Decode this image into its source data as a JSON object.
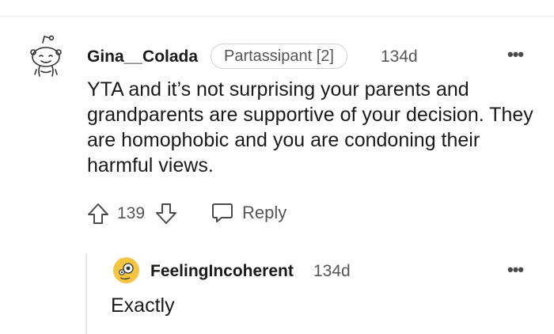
{
  "comment": {
    "username": "Gina__Colada",
    "flair": "Partassipant [2]",
    "time": "134d",
    "body": "YTA and it’s not surprising your parents and grandparents are supportive of your decision. They are homophobic and you are condoning their harmful views.",
    "votes": "139",
    "reply_label": "Reply",
    "more_label": "•••"
  },
  "reply": {
    "username": "FeelingIncoherent",
    "time": "134d",
    "body": "Exactly",
    "more_label": "•••"
  },
  "icons": {
    "main_avatar": "snoo-avatar-icon",
    "reply_avatar": "snoo-yellow-avatar-icon",
    "upvote": "upvote-arrow-icon",
    "downvote": "downvote-arrow-icon",
    "reply": "speech-bubble-icon",
    "more": "more-options-icon"
  },
  "colors": {
    "reply_avatar_bg": "#f5c542",
    "meta_text": "#555555",
    "divider": "#edeff1"
  }
}
